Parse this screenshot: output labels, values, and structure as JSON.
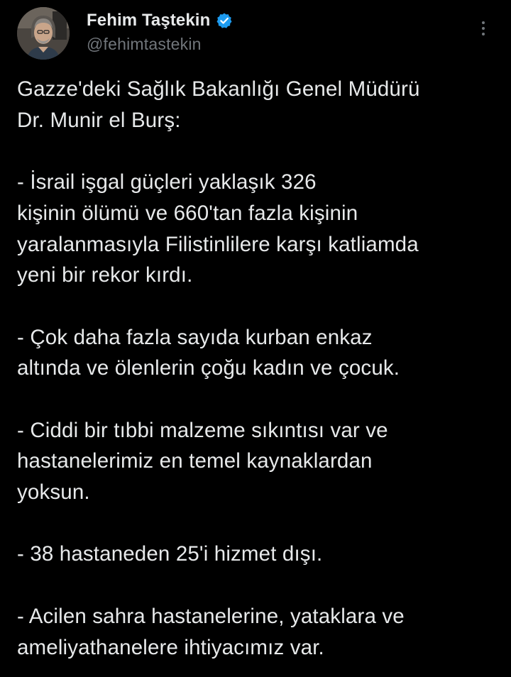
{
  "author": {
    "display_name": "Fehim Taştekin",
    "handle": "@fehimtastekin",
    "verified": true,
    "verified_color": "#1d9bf0",
    "avatar_icon": "profile-photo"
  },
  "menu": {
    "more_icon": "more-vertical-icon"
  },
  "tweet": {
    "paragraphs": [
      "Gazze'deki Sağlık Bakanlığı Genel Müdürü\nDr. Munir el Burş:",
      "- İsrail işgal güçleri yaklaşık 326\nkişinin ölümü ve 660'tan fazla kişinin\nyaralanmasıyla Filistinlilere karşı katliamda\nyeni bir rekor kırdı.",
      "- Çok daha fazla sayıda kurban enkaz\naltında ve ölenlerin çoğu kadın ve çocuk.",
      "- Ciddi bir tıbbi malzeme sıkıntısı var ve\nhastanelerimiz en temel kaynaklardan\nyoksun.",
      "- 38 hastaneden 25'i hizmet dışı.",
      "- Acilen sahra hastanelerine, yataklara ve\nameliyathanelere ihtiyacımız var."
    ]
  },
  "colors": {
    "background": "#000000",
    "text_primary": "#e7e9ea",
    "text_secondary": "#71767b"
  }
}
